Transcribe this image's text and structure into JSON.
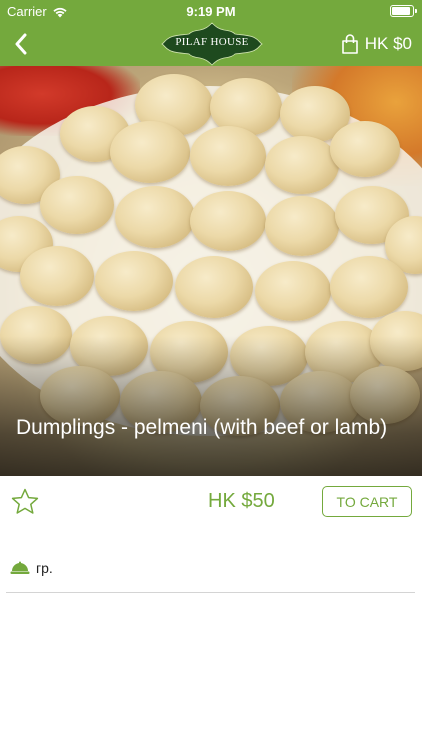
{
  "status_bar": {
    "carrier": "Carrier",
    "time": "9:19 PM"
  },
  "nav": {
    "logo_text": "PILAF HOUSE",
    "cart_total": "HK $0"
  },
  "product": {
    "title": "Dumplings - pelmeni (with beef or lamb)",
    "price": "HK $50",
    "to_cart_label": "TO CART",
    "weight_unit": "гр."
  },
  "theme": {
    "accent": "#74a93d",
    "logo_bg": "#1e4a1e"
  },
  "icons": [
    "wifi-icon",
    "battery-icon",
    "back-chevron-icon",
    "shopping-bag-icon",
    "star-outline-icon",
    "cloche-icon"
  ]
}
